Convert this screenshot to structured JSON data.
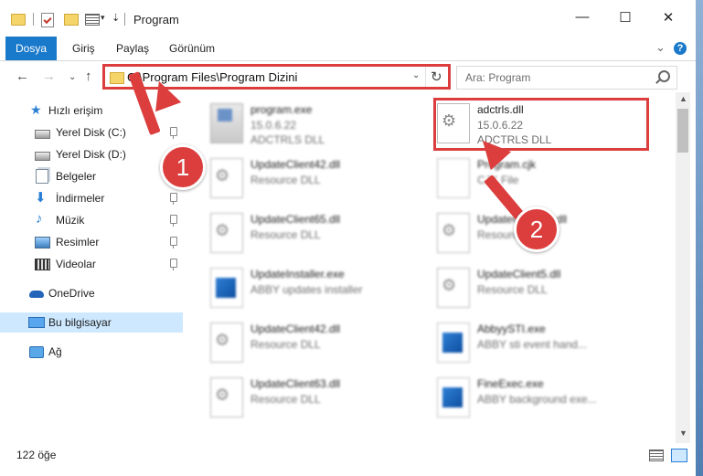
{
  "window": {
    "title": "Program"
  },
  "ribbon": {
    "file_tab": "Dosya",
    "tabs": [
      "Giriş",
      "Paylaş",
      "Görünüm"
    ]
  },
  "nav": {
    "address": "C:\\Program Files\\Program Dizini",
    "search_placeholder": "Ara: Program"
  },
  "sidebar": {
    "items": [
      {
        "label": "Hızlı erişim",
        "icon": "star-icon"
      },
      {
        "label": "Yerel Disk (C:)",
        "icon": "drive-icon"
      },
      {
        "label": "Yerel Disk (D:)",
        "icon": "drive-icon"
      },
      {
        "label": "Belgeler",
        "icon": "documents-icon"
      },
      {
        "label": "İndirmeler",
        "icon": "download-icon"
      },
      {
        "label": "Müzik",
        "icon": "music-icon"
      },
      {
        "label": "Resimler",
        "icon": "pictures-icon"
      },
      {
        "label": "Videolar",
        "icon": "videos-icon"
      },
      {
        "label": "OneDrive",
        "icon": "onedrive-icon"
      },
      {
        "label": "Bu bilgisayar",
        "icon": "computer-icon"
      },
      {
        "label": "Ağ",
        "icon": "network-icon"
      }
    ]
  },
  "files": [
    {
      "name": "program.exe",
      "line1": "15.0.6.22",
      "line2": "ADCTRLS DLL"
    },
    {
      "name": "adctrls.dll",
      "line1": "15.0.6.22",
      "line2": "ADCTRLS DLL"
    },
    {
      "name": "UpdateClient42.dll",
      "line1": "Resource DLL",
      "line2": ""
    },
    {
      "name": "Program.cjk",
      "line1": "CJK File",
      "line2": ""
    },
    {
      "name": "UpdateClient65.dll",
      "line1": "Resource DLL",
      "line2": ""
    },
    {
      "name": "UpdateClient63.dll",
      "line1": "Resource DLL",
      "line2": ""
    },
    {
      "name": "UpdateInstaller.exe",
      "line1": "ABBY updates installer",
      "line2": ""
    },
    {
      "name": "UpdateClient5.dll",
      "line1": "Resource DLL",
      "line2": ""
    },
    {
      "name": "UpdateClient42.dll",
      "line1": "Resource DLL",
      "line2": ""
    },
    {
      "name": "AbbyySTI.exe",
      "line1": "ABBY sti event hand...",
      "line2": ""
    },
    {
      "name": "UpdateClient63.dll",
      "line1": "Resource DLL",
      "line2": ""
    },
    {
      "name": "FineExec.exe",
      "line1": "ABBY background exe...",
      "line2": ""
    }
  ],
  "status": {
    "count": "122 öğe"
  },
  "callouts": {
    "one": "1",
    "two": "2"
  },
  "colors": {
    "accent": "#1979ca",
    "highlight": "#dc3e3e",
    "selected": "#cde8ff"
  }
}
